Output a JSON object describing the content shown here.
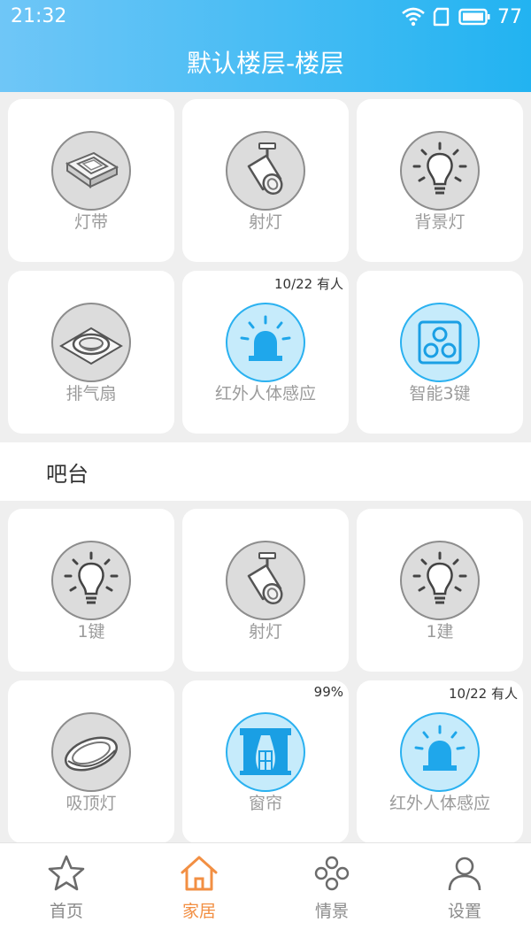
{
  "status_bar": {
    "time": "21:32",
    "battery": "77"
  },
  "header": {
    "title": "默认楼层-楼层"
  },
  "room1": {
    "cards": [
      {
        "label": "灯带",
        "icon": "led-strip-icon",
        "badge": ""
      },
      {
        "label": "射灯",
        "icon": "spotlight-icon",
        "badge": ""
      },
      {
        "label": "背景灯",
        "icon": "bulb-icon",
        "badge": ""
      },
      {
        "label": "排气扇",
        "icon": "exhaust-fan-icon",
        "badge": ""
      },
      {
        "label": "红外人体感应",
        "icon": "alarm-sensor-icon",
        "badge": "10/22 有人"
      },
      {
        "label": "智能3键",
        "icon": "three-key-switch-icon",
        "badge": ""
      }
    ]
  },
  "room2": {
    "title": "吧台",
    "cards": [
      {
        "label": "1键",
        "icon": "bulb-icon",
        "badge": ""
      },
      {
        "label": "射灯",
        "icon": "spotlight-icon",
        "badge": ""
      },
      {
        "label": "1建",
        "icon": "bulb-icon",
        "badge": ""
      },
      {
        "label": "吸顶灯",
        "icon": "ceiling-light-icon",
        "badge": ""
      },
      {
        "label": "窗帘",
        "icon": "curtain-icon",
        "badge": "99%"
      },
      {
        "label": "红外人体感应",
        "icon": "alarm-sensor-icon",
        "badge": "10/22 有人"
      }
    ]
  },
  "colors": {
    "header_start": "#6fc6f7",
    "header_end": "#22b3f1",
    "active_icon_bg": "#c6ebfb",
    "active_tab": "#f28f43"
  },
  "tabbar": {
    "tabs": [
      {
        "label": "首页",
        "icon": "star-icon"
      },
      {
        "label": "家居",
        "icon": "home-icon"
      },
      {
        "label": "情景",
        "icon": "scene-icon"
      },
      {
        "label": "设置",
        "icon": "person-icon"
      }
    ],
    "active": "家居"
  }
}
